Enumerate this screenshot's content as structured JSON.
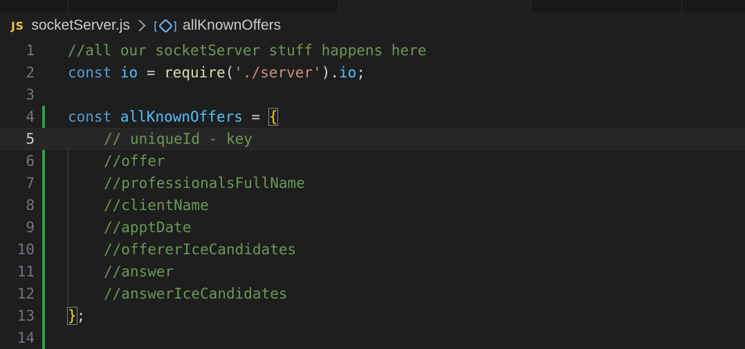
{
  "breadcrumb": {
    "lang_badge": "JS",
    "file": "socketServer.js",
    "symbol_icon": "symbol-variable-icon",
    "symbol": "allKnownOffers"
  },
  "editor": {
    "active_line": 5,
    "lines": [
      {
        "n": "1",
        "comment": "//all our socketServer stuff happens here"
      },
      {
        "n": "2",
        "kw": "const",
        "var": "io",
        "op": " = ",
        "fn": "require",
        "p1": "(",
        "str": "'./server'",
        "p2": ").",
        "prop": "io",
        "p3": ";"
      },
      {
        "n": "3"
      },
      {
        "n": "4",
        "kw": "const",
        "var": "allKnownOffers",
        "op": " = ",
        "brace": "{"
      },
      {
        "n": "5",
        "comment": "// uniqueId - key"
      },
      {
        "n": "6",
        "comment": "//offer"
      },
      {
        "n": "7",
        "comment": "//professionalsFullName"
      },
      {
        "n": "8",
        "comment": "//clientName"
      },
      {
        "n": "9",
        "comment": "//apptDate"
      },
      {
        "n": "10",
        "comment": "//offererIceCandidates"
      },
      {
        "n": "11",
        "comment": "//answer"
      },
      {
        "n": "12",
        "comment": "//answerIceCandidates"
      },
      {
        "n": "13",
        "brace": "}",
        "punc": ";"
      },
      {
        "n": "14"
      }
    ]
  },
  "colors": {
    "background": "#1e1e1e",
    "comment": "#6a9955",
    "keyword": "#569cd6",
    "variable": "#9cdcfe",
    "string": "#ce9178",
    "function": "#dcdcaa",
    "bracket": "#ffd700",
    "git_added": "#2ea043"
  }
}
